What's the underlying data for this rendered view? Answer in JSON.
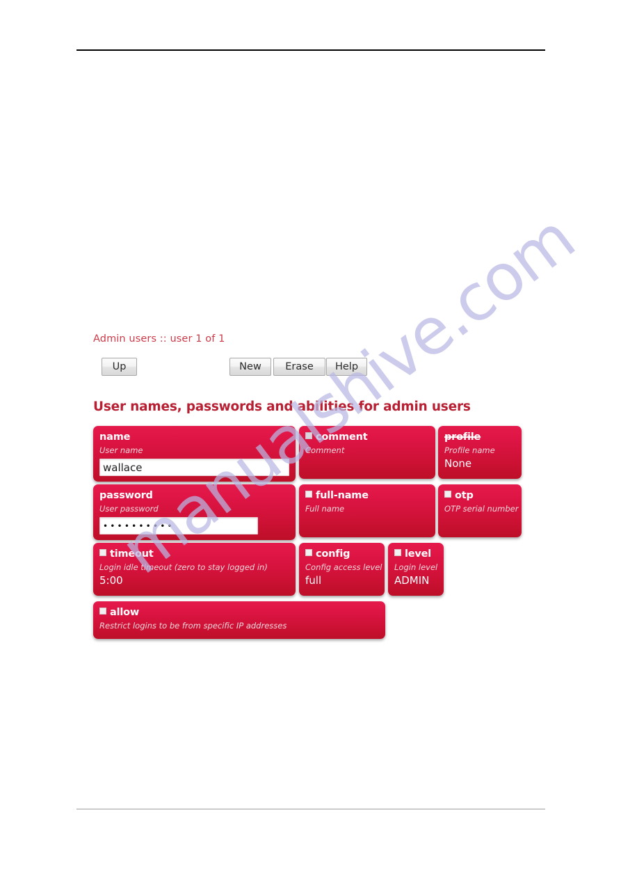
{
  "page": {
    "breadcrumb": "Admin users :: user 1 of 1",
    "section_heading": "User names, passwords and abilities for admin users",
    "watermark": "manualshive.com",
    "accent_red": "#cc1134",
    "heading_red": "#b81f33",
    "breadcrumb_red": "#cc3b49",
    "watermark_color": "#b9b8e4"
  },
  "toolbar": {
    "up_label": "Up",
    "new_label": "New",
    "erase_label": "Erase",
    "help_label": "Help"
  },
  "fields": {
    "name": {
      "title": "name",
      "desc": "User name",
      "value": "wallace",
      "checkbox": false
    },
    "comment": {
      "title": "comment",
      "desc": "Comment",
      "value": "",
      "checkbox": true
    },
    "profile": {
      "title": "profile",
      "desc": "Profile name",
      "value": "None",
      "checkbox": false,
      "struck": true
    },
    "password": {
      "title": "password",
      "desc": "User password",
      "value": "••••••••••",
      "checkbox": false
    },
    "full_name": {
      "title": "full-name",
      "desc": "Full name",
      "value": "",
      "checkbox": true
    },
    "otp": {
      "title": "otp",
      "desc": "OTP serial number",
      "value": "",
      "checkbox": true
    },
    "timeout": {
      "title": "timeout",
      "desc": "Login idle timeout (zero to stay logged in)",
      "value": "5:00",
      "checkbox": true
    },
    "config": {
      "title": "config",
      "desc": "Config access level",
      "value": "full",
      "checkbox": true
    },
    "level": {
      "title": "level",
      "desc": "Login level",
      "value": "ADMIN",
      "checkbox": true
    },
    "allow": {
      "title": "allow",
      "desc": "Restrict logins to be from specific IP addresses",
      "value": "",
      "checkbox": true
    }
  }
}
